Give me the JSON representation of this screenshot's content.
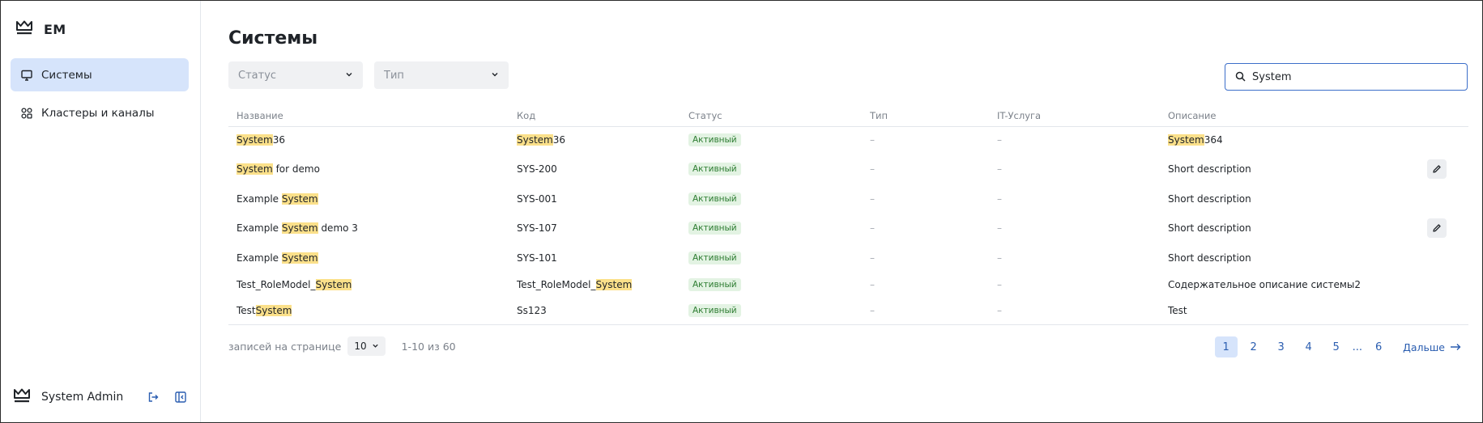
{
  "brand": {
    "name": "EM",
    "logo_icon": "crown-icon"
  },
  "sidebar": {
    "items": [
      {
        "label": "Системы",
        "icon": "monitor-icon",
        "active": true
      },
      {
        "label": "Кластеры и каналы",
        "icon": "grid-icon",
        "active": false
      }
    ],
    "user": {
      "name": "System Admin"
    }
  },
  "main": {
    "title": "Системы",
    "filters": {
      "status_placeholder": "Статус",
      "type_placeholder": "Тип"
    },
    "search": {
      "value": "System",
      "query_highlight": "System"
    },
    "table": {
      "columns": [
        "Название",
        "Код",
        "Статус",
        "Тип",
        "IT-Услуга",
        "Описание"
      ],
      "rows": [
        {
          "name": "System36",
          "code": "System36",
          "status": "Активный",
          "type": "–",
          "service": "–",
          "description": "System364",
          "editable": false
        },
        {
          "name": "System for demo",
          "code": "SYS-200",
          "status": "Активный",
          "type": "–",
          "service": "–",
          "description": "Short description",
          "editable": true
        },
        {
          "name": "Example System",
          "code": "SYS-001",
          "status": "Активный",
          "type": "–",
          "service": "–",
          "description": "Short description",
          "editable": false
        },
        {
          "name": "Example System demo 3",
          "code": "SYS-107",
          "status": "Активный",
          "type": "–",
          "service": "–",
          "description": "Short description",
          "editable": true
        },
        {
          "name": "Example System",
          "code": "SYS-101",
          "status": "Активный",
          "type": "–",
          "service": "–",
          "description": "Short description",
          "editable": false
        },
        {
          "name": "Test_RoleModel_System",
          "code": "Test_RoleModel_System",
          "status": "Активный",
          "type": "–",
          "service": "–",
          "description": "Содержательное описание системы2",
          "editable": false
        },
        {
          "name": "TestSystem",
          "code": "Ss123",
          "status": "Активный",
          "type": "–",
          "service": "–",
          "description": "Test",
          "editable": false
        }
      ]
    },
    "pagination": {
      "per_page_label": "записей на странице",
      "per_page_value": "10",
      "range_text": "1-10 из 60",
      "pages": [
        "1",
        "2",
        "3",
        "4",
        "5"
      ],
      "ellipsis": "...",
      "last_page": "6",
      "current_page": "1",
      "next_label": "Дальше"
    }
  },
  "colors": {
    "accent": "#3c6ec9",
    "active_nav_bg": "#d6e4fb",
    "highlight": "#fbe08a",
    "badge_bg": "#e3f3e3",
    "badge_text": "#2e7d32"
  }
}
